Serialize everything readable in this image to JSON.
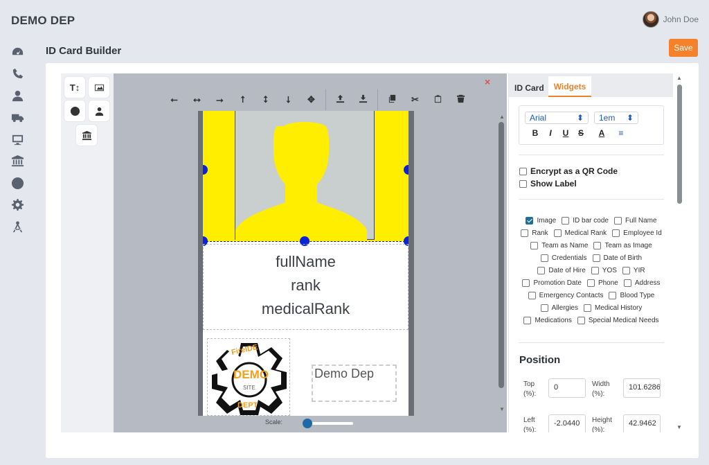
{
  "app": {
    "brand": "DEMO DEP",
    "user_name": "John Doe"
  },
  "sidebar": {
    "icons": [
      "dashboard-icon",
      "phone-icon",
      "user-icon",
      "truck-icon",
      "monitor-icon",
      "bank-icon",
      "clock-icon",
      "gear-icon",
      "compass-icon"
    ]
  },
  "page": {
    "title": "ID Card Builder",
    "save_label": "Save"
  },
  "tools": {
    "text_tool": "T↕"
  },
  "canvas": {
    "close": "×",
    "toolbar": [
      "align-left-icon",
      "align-center-h-icon",
      "align-right-icon",
      "align-top-icon",
      "align-middle-v-icon",
      "align-bottom-icon",
      "move-icon",
      "bring-front-icon",
      "send-back-icon",
      "copy-icon",
      "cut-icon",
      "paste-icon",
      "trash-icon"
    ],
    "card": {
      "lines": [
        "fullName",
        "rank",
        "medicalRank"
      ],
      "dep_text": "Demo Dep",
      "logo": {
        "top": "FireIDE",
        "center": "DEMO",
        "sub": "SITE",
        "bottom": "DEPT"
      }
    },
    "scale_label": "Scale:",
    "scale_value": 0.05
  },
  "panel": {
    "tabs": [
      {
        "label": "ID Card"
      },
      {
        "label": "Widgets"
      }
    ],
    "font": {
      "family": "Arial",
      "size": "1em",
      "buttons": [
        "B",
        "I",
        "U",
        "S",
        "A",
        "≡"
      ]
    },
    "options": {
      "encrypt_qr": "Encrypt as a QR Code",
      "show_label": "Show Label"
    },
    "widgets": [
      [
        "Image",
        "ID bar code",
        "Full Name"
      ],
      [
        "Rank",
        "Medical Rank",
        "Employee Id"
      ],
      [
        "Team as Name",
        "Team as Image"
      ],
      [
        "Credentials",
        "Date of Birth"
      ],
      [
        "Date of Hire",
        "YOS",
        "YIR"
      ],
      [
        "Promotion Date",
        "Phone",
        "Address"
      ],
      [
        "Emergency Contacts",
        "Blood Type"
      ],
      [
        "Allergies",
        "Medical History"
      ],
      [
        "Medications",
        "Special Medical Needs"
      ]
    ],
    "position": {
      "title": "Position",
      "top_label": "Top (%):",
      "top_value": "0",
      "width_label": "Width (%):",
      "width_value": "101.6286",
      "left_label": "Left (%):",
      "left_value": "-2.0440",
      "height_label": "Height (%):",
      "height_value": "42.9462"
    }
  }
}
